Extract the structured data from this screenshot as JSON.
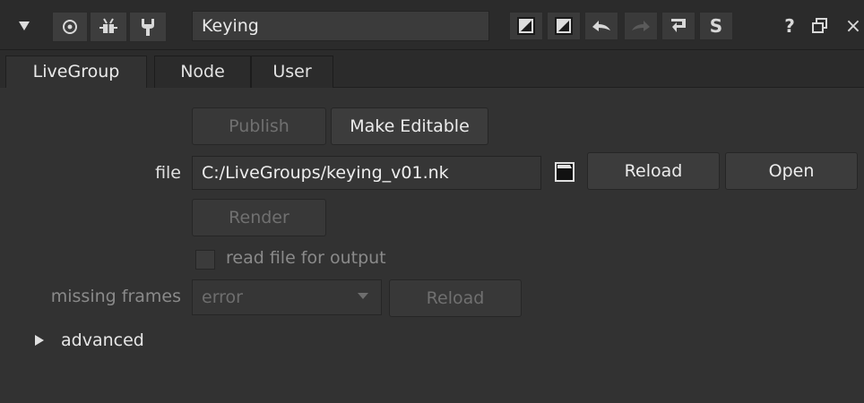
{
  "titlebar": {
    "node_name": "Keying",
    "icons": [
      "collapse-triangle-icon",
      "target-circle-icon",
      "bug-icon",
      "wrench-icon",
      "color-swatch-1-icon",
      "color-swatch-2-icon",
      "undo-icon",
      "redo-icon",
      "revert-icon",
      "s-icon",
      "help-icon",
      "float-icon",
      "close-icon"
    ],
    "s_label": "S",
    "help_label": "?",
    "close_label": "×"
  },
  "tabs": [
    {
      "label": "LiveGroup",
      "active": true
    },
    {
      "label": "Node",
      "active": false
    },
    {
      "label": "User",
      "active": false
    }
  ],
  "panel": {
    "publish_label": "Publish",
    "make_editable_label": "Make Editable",
    "file_label": "file",
    "file_value": "C:/LiveGroups/keying_v01.nk",
    "reload_label": "Reload",
    "open_label": "Open",
    "render_label": "Render",
    "read_file_label": "read file for output",
    "missing_frames_label": "missing frames",
    "missing_frames_value": "error",
    "reload2_label": "Reload",
    "advanced_label": "advanced"
  },
  "colors": {
    "background": "#323232",
    "titlebar": "#2b2b2b",
    "button": "#3c3c3c"
  }
}
